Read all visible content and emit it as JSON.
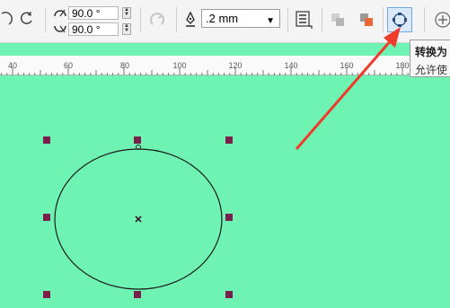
{
  "toolbar": {
    "angle_top": "90.0 °",
    "angle_bottom": "90.0 °",
    "outline_width": ".2 mm",
    "icons": {
      "undo": "arc-rotate-icon",
      "undo2": "arc-rotate-icon",
      "angle_top_icon": "arc-angle-icon",
      "angle_bottom_icon": "arc-angle-icon",
      "direction": "direction-icon",
      "outline": "pen-nib-icon",
      "wrap_text": "wrap-text-icon",
      "shape_a": "shape-icon",
      "shape_b": "shape-icon",
      "convert": "convert-to-curves-icon",
      "add": "plus-icon"
    }
  },
  "ruler": {
    "labels": [
      "40",
      "60",
      "80",
      "100",
      "120",
      "140",
      "160",
      "180"
    ]
  },
  "tooltip": {
    "title": "转换为",
    "desc": "允许使"
  },
  "colors": {
    "canvas": "#6ff3b3",
    "handle": "#7a1f4b",
    "arrow": "#ef3b2c",
    "tool_active": "#dbeafa"
  }
}
